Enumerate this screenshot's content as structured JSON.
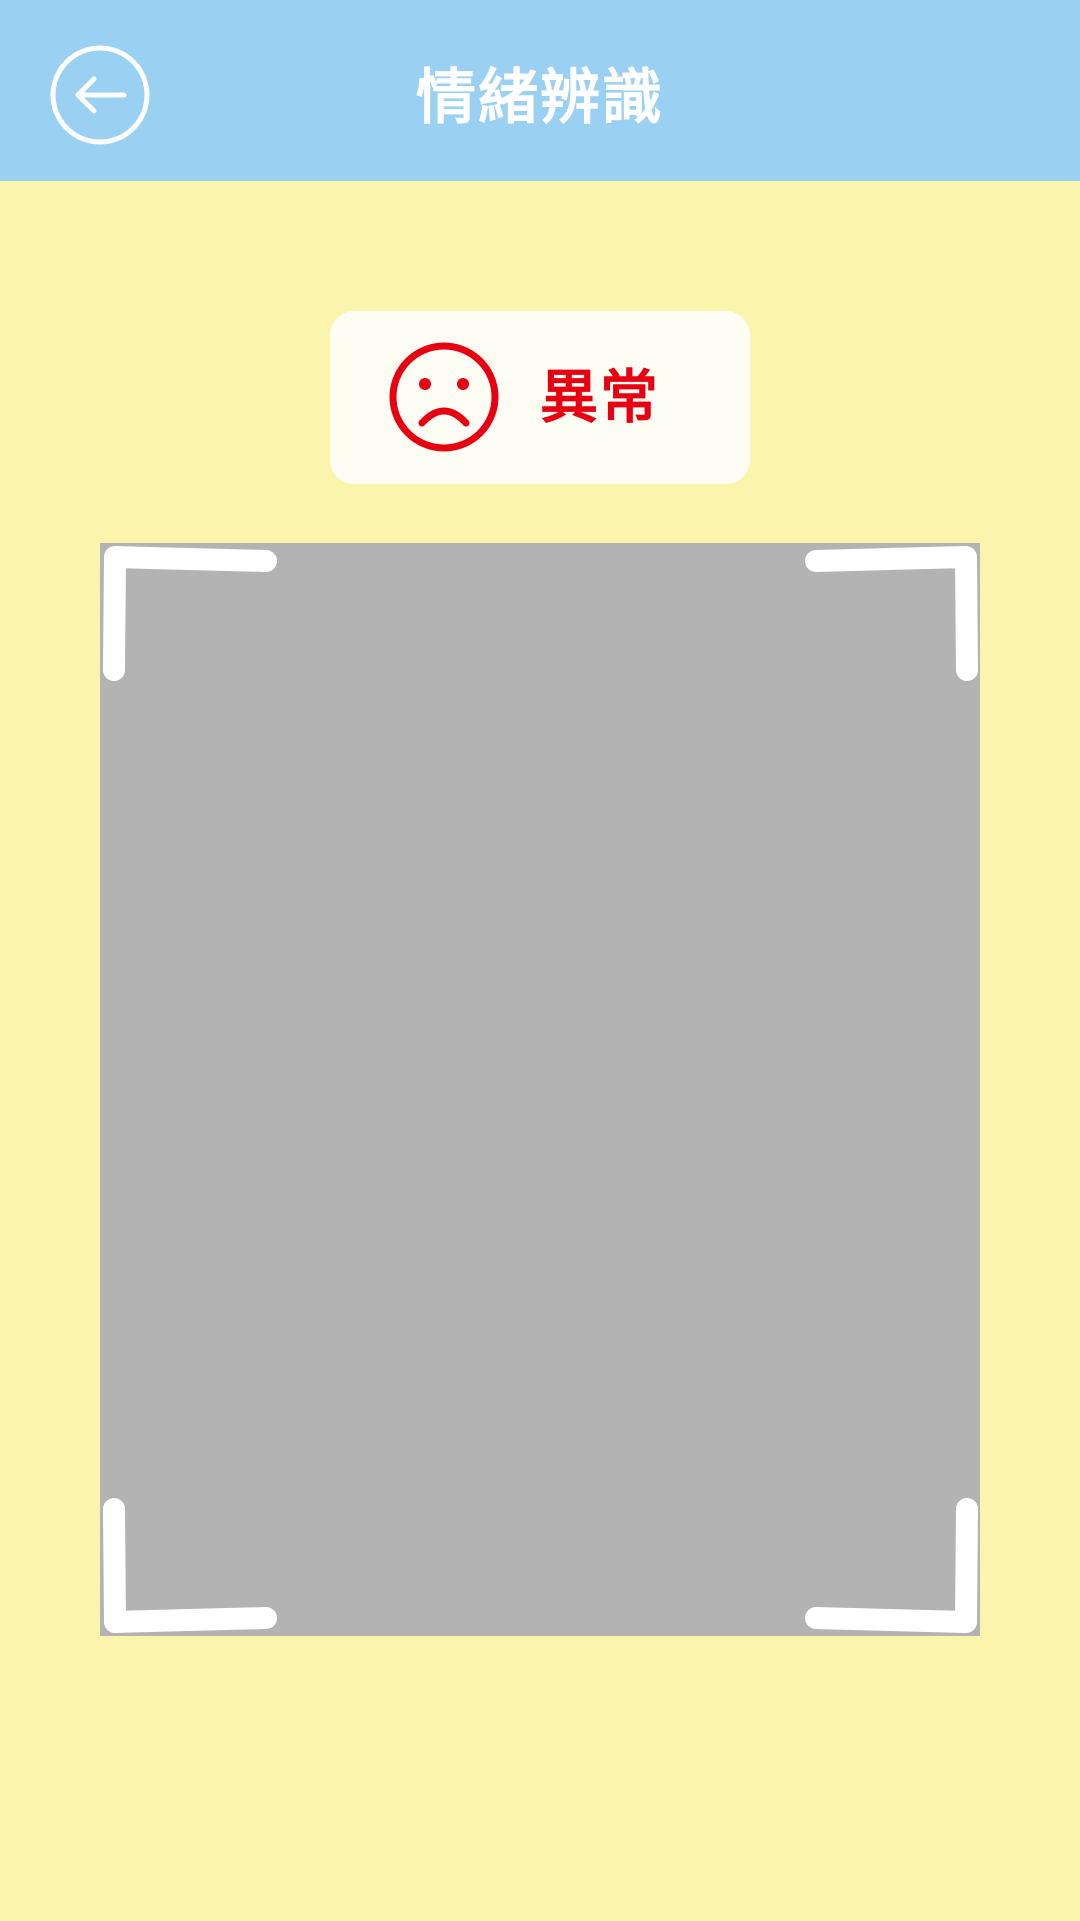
{
  "header": {
    "title": "情緒辨識",
    "back_icon": "back-arrow-icon",
    "background_color": "#9AD0F1"
  },
  "status": {
    "icon": "sad-face-icon",
    "label": "異常",
    "color": "#E60012"
  },
  "camera": {
    "background_color": "#B3B3B3",
    "frame_icon": "scan-frame-corners-icon"
  },
  "page": {
    "background_color": "#FBF4AD"
  }
}
